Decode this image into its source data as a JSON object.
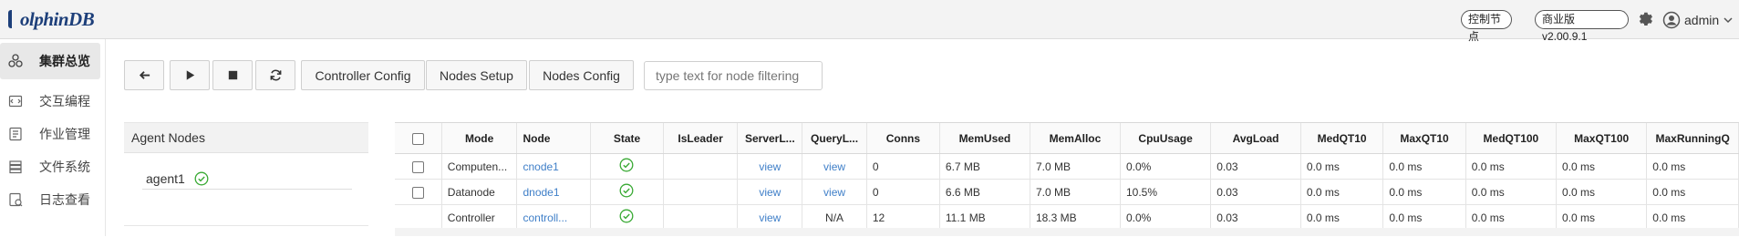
{
  "header": {
    "logo_text": "olphinDB",
    "control_node_label": "控制节点",
    "version_label": "商业版 v2.00.9.1",
    "user_name": "admin"
  },
  "sidebar": {
    "items": [
      {
        "label": "集群总览",
        "icon": "cluster-icon",
        "active": true
      },
      {
        "label": "交互编程",
        "icon": "code-icon"
      },
      {
        "label": "作业管理",
        "icon": "job-icon"
      },
      {
        "label": "文件系统",
        "icon": "storage-icon"
      },
      {
        "label": "日志查看",
        "icon": "log-icon"
      }
    ]
  },
  "toolbar": {
    "back_icon": "arrow-left-icon",
    "start_icon": "play-icon",
    "stop_icon": "stop-icon",
    "refresh_icon": "refresh-icon",
    "controller_config": "Controller Config",
    "nodes_setup": "Nodes Setup",
    "nodes_config": "Nodes Config",
    "filter_placeholder": "type text for node filtering"
  },
  "agents": {
    "title": "Agent Nodes",
    "items": [
      {
        "name": "agent1",
        "status": "ok"
      }
    ]
  },
  "table": {
    "headers": [
      "Mode",
      "Node",
      "State",
      "IsLeader",
      "ServerL...",
      "QueryL...",
      "Conns",
      "MemUsed",
      "MemAlloc",
      "CpuUsage",
      "AvgLoad",
      "MedQT10",
      "MaxQT10",
      "MedQT100",
      "MaxQT100",
      "MaxRunningQ"
    ],
    "rows": [
      {
        "mode": "Computen...",
        "node": "cnode1",
        "leader": "",
        "server_log": "view",
        "query_log": "view",
        "conns": "0",
        "mem_used": "6.7 MB",
        "mem_alloc": "7.0 MB",
        "cpu": "0.0%",
        "avg_load": "0.03",
        "med10": "0.0 ms",
        "max10": "0.0 ms",
        "med100": "0.0 ms",
        "max100": "0.0 ms",
        "maxrun": "0.0 ms"
      },
      {
        "mode": "Datanode",
        "node": "dnode1",
        "leader": "",
        "server_log": "view",
        "query_log": "view",
        "conns": "0",
        "mem_used": "6.6 MB",
        "mem_alloc": "7.0 MB",
        "cpu": "10.5%",
        "avg_load": "0.03",
        "med10": "0.0 ms",
        "max10": "0.0 ms",
        "med100": "0.0 ms",
        "max100": "0.0 ms",
        "maxrun": "0.0 ms"
      },
      {
        "mode": "Controller",
        "node": "controll...",
        "leader": "",
        "server_log": "view",
        "query_log": "N/A",
        "conns": "12",
        "mem_used": "11.1 MB",
        "mem_alloc": "18.3 MB",
        "cpu": "0.0%",
        "avg_load": "0.03",
        "med10": "0.0 ms",
        "max10": "0.0 ms",
        "med100": "0.0 ms",
        "max100": "0.0 ms",
        "maxrun": "0.0 ms"
      }
    ]
  },
  "colors": {
    "accent": "#3f7fc8",
    "ok": "#3aaa35",
    "brand": "#1d3f7a"
  }
}
